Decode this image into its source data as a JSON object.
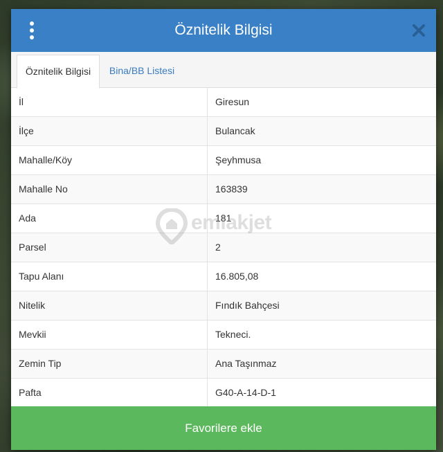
{
  "dialog": {
    "title": "Öznitelik Bilgisi",
    "menu_icon": "kebab-menu-icon",
    "close_icon": "close-icon"
  },
  "tabs": [
    {
      "label": "Öznitelik Bilgisi",
      "active": true
    },
    {
      "label": "Bina/BB Listesi",
      "active": false
    }
  ],
  "attributes": [
    {
      "key": "İl",
      "value": "Giresun"
    },
    {
      "key": "İlçe",
      "value": "Bulancak"
    },
    {
      "key": "Mahalle/Köy",
      "value": "Şeyhmusa"
    },
    {
      "key": "Mahalle No",
      "value": "163839"
    },
    {
      "key": "Ada",
      "value": "181"
    },
    {
      "key": "Parsel",
      "value": "2"
    },
    {
      "key": "Tapu Alanı",
      "value": "16.805,08"
    },
    {
      "key": "Nitelik",
      "value": "Fındık Bahçesi"
    },
    {
      "key": "Mevkii",
      "value": "Tekneci."
    },
    {
      "key": "Zemin Tip",
      "value": "Ana Taşınmaz"
    },
    {
      "key": "Pafta",
      "value": "G40-A-14-D-1"
    }
  ],
  "footer": {
    "favorite_label": "Favorilere ekle"
  },
  "watermark": {
    "text": "emlakjet"
  },
  "colors": {
    "header": "#3a80c6",
    "tab_link": "#3a7bbf",
    "favorite_button": "#5cb85c"
  }
}
